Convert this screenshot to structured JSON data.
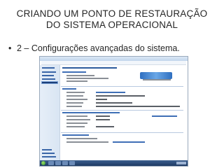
{
  "slide": {
    "title_line1": "CRIANDO  UM  PONTO  DE  RESTAURAÇÃO",
    "title_line2": "DO SISTEMA OPERACIONAL",
    "bullet_mark": "•",
    "bullet_text": "2 – Configurações avançadas do sistema."
  },
  "screenshot": {
    "theme_colors": {
      "titlebar": "#c2d5ec",
      "sidebar": "#dde8f5",
      "link": "#3a66a8",
      "taskbar": "#1e3a63",
      "start_orb": "#2b8f2b"
    },
    "icons": [
      "start-orb-icon",
      "windows-logo-icon"
    ]
  }
}
